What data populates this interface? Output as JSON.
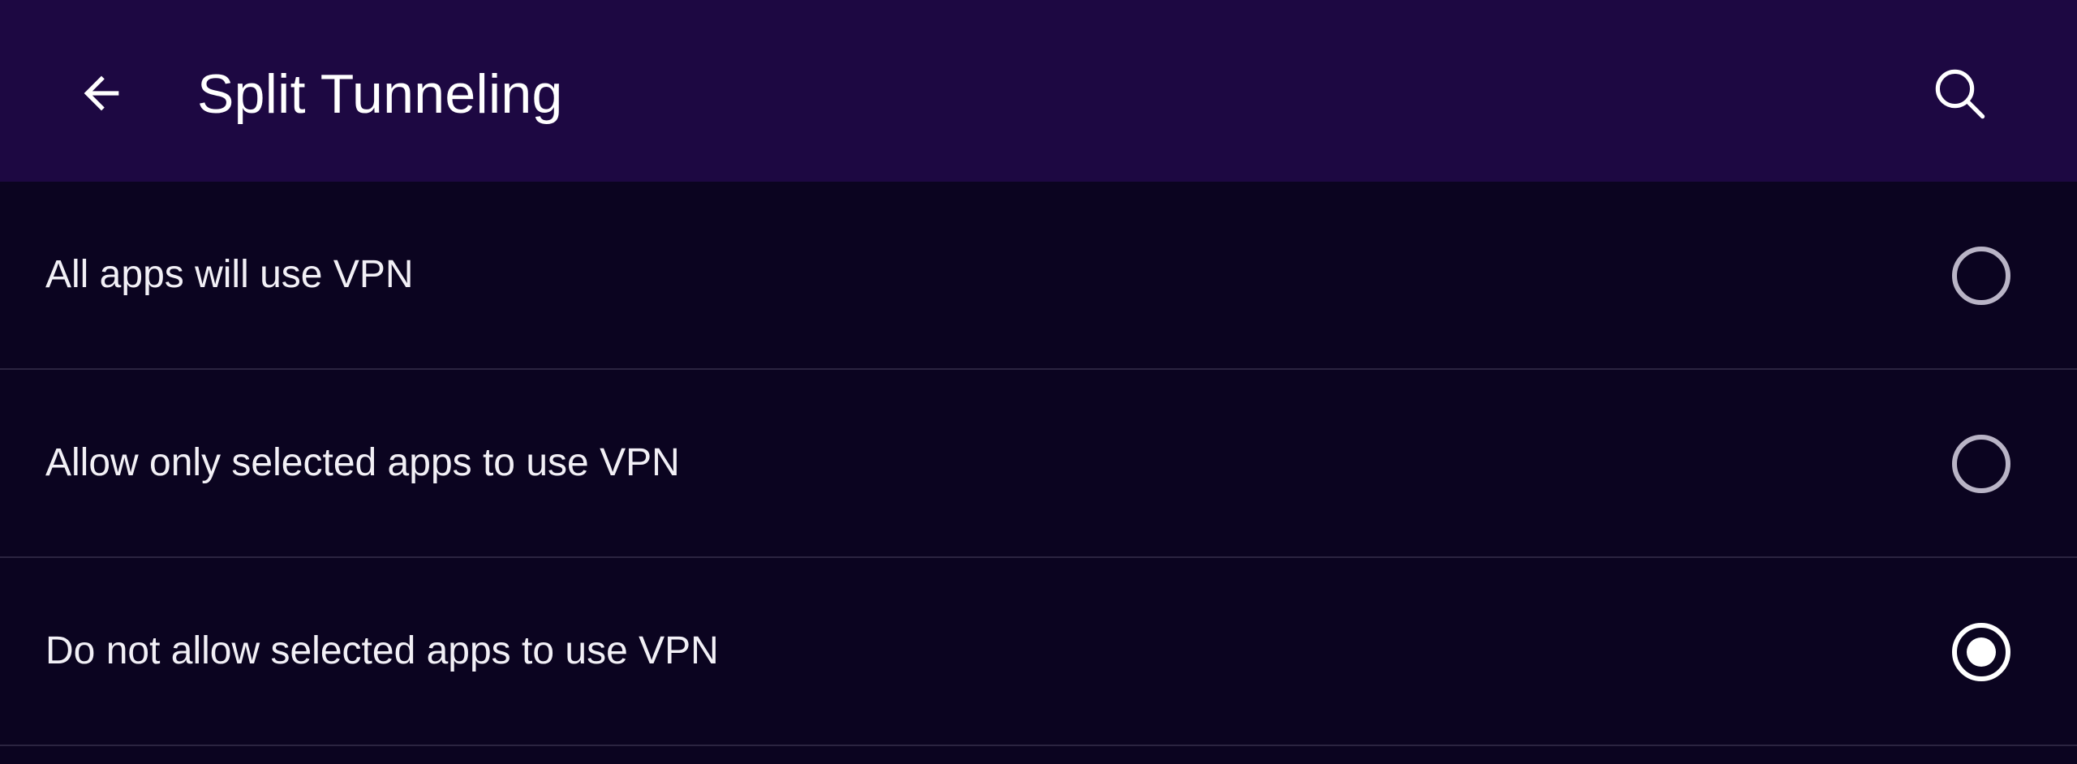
{
  "app_bar": {
    "title": "Split Tunneling",
    "back_icon": "arrow-left-icon",
    "search_icon": "search-icon",
    "background_color": "#1d0842"
  },
  "options": [
    {
      "label": "All apps will use VPN",
      "selected": false
    },
    {
      "label": "Allow only selected apps to use VPN",
      "selected": false
    },
    {
      "label": "Do not allow selected apps to use VPN",
      "selected": true
    }
  ],
  "colors": {
    "page_background": "#0b0420",
    "divider": "#2b2440",
    "radio_unselected": "#b9b4c6",
    "radio_selected": "#ffffff"
  }
}
